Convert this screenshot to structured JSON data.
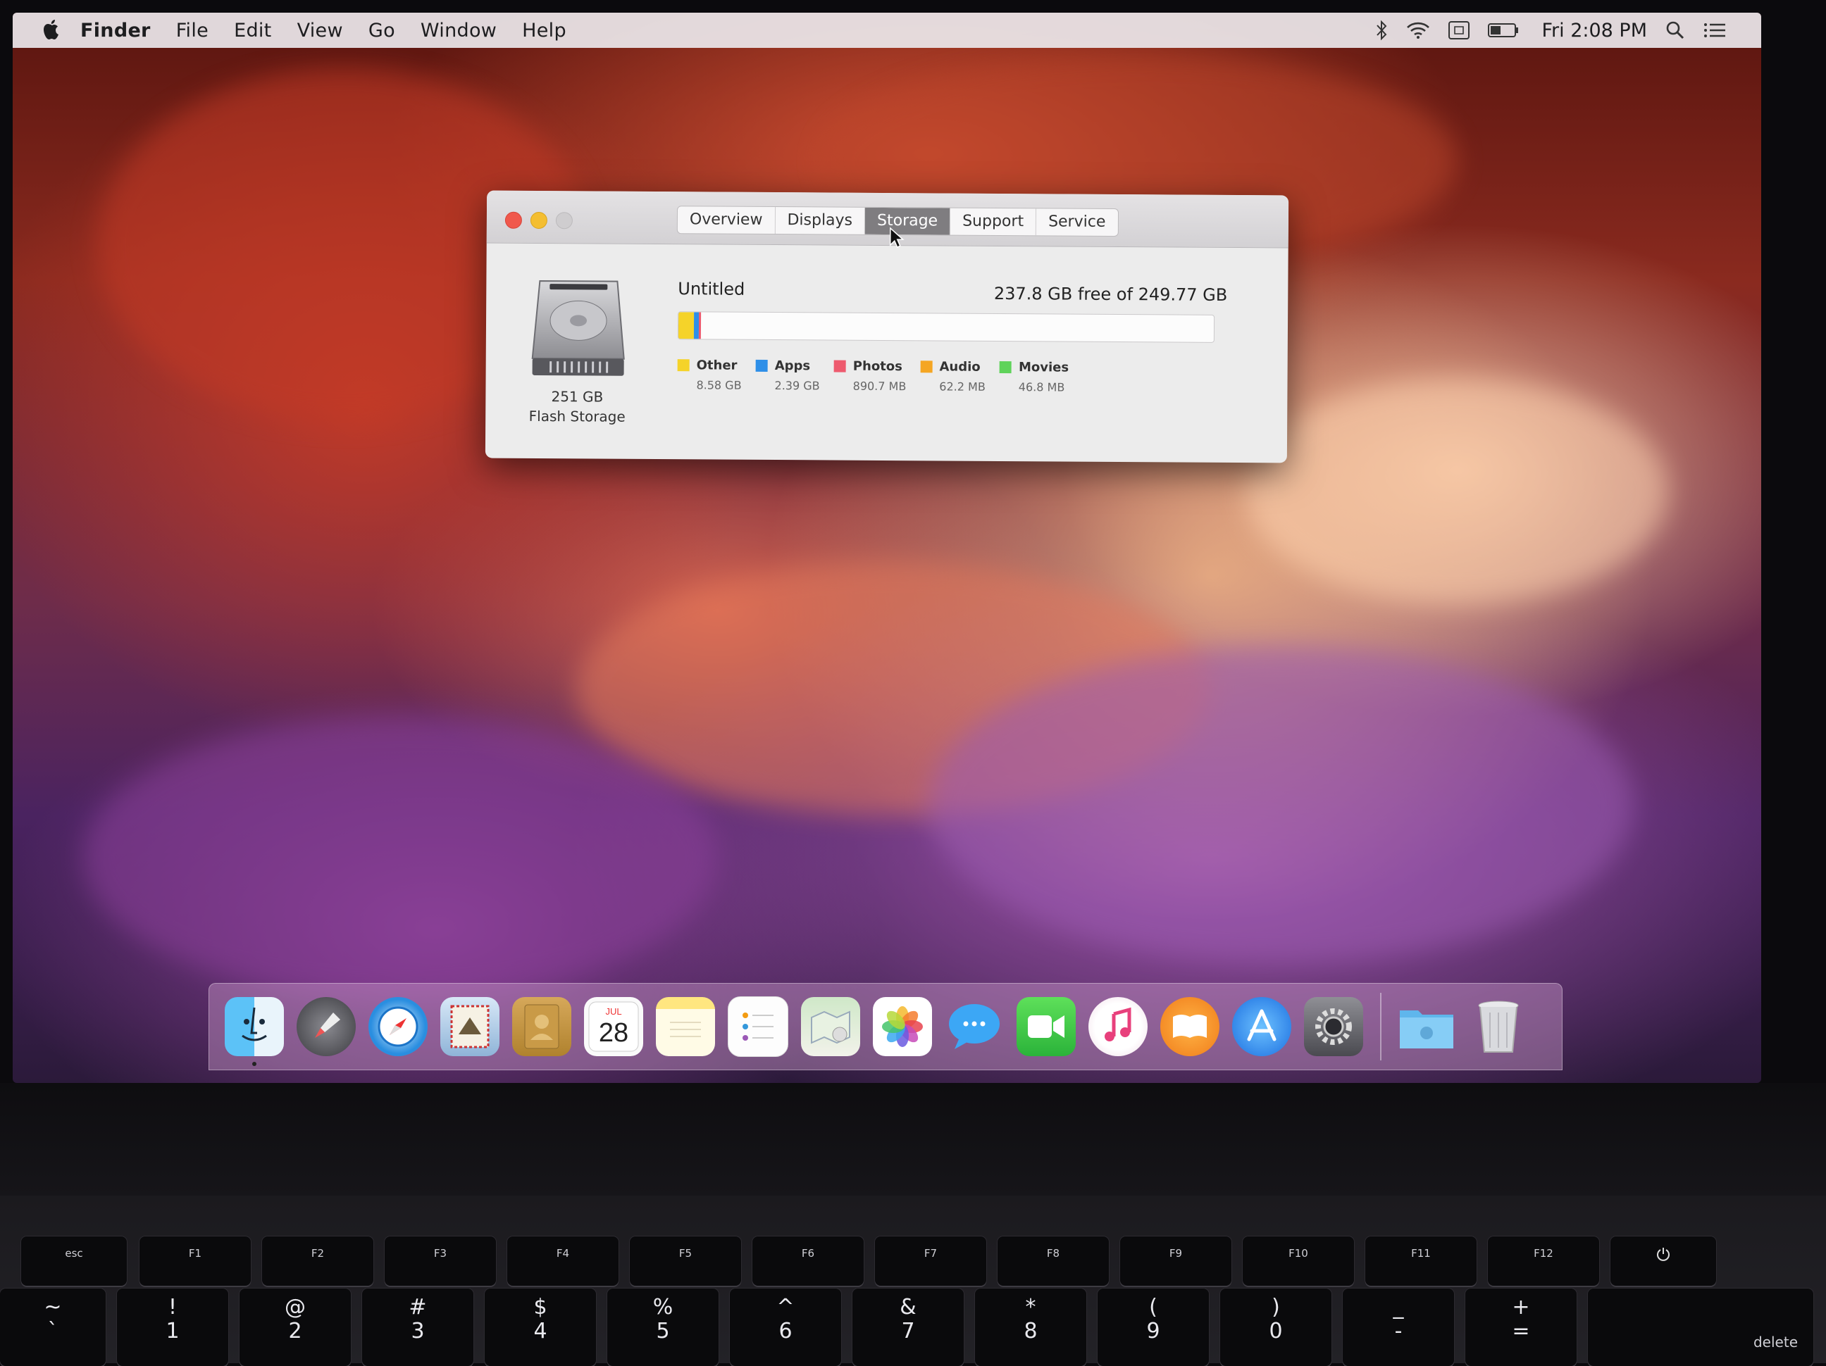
{
  "menubar": {
    "app_name": "Finder",
    "menus": [
      "File",
      "Edit",
      "View",
      "Go",
      "Window",
      "Help"
    ],
    "clock": "Fri 2:08 PM"
  },
  "about_window": {
    "tabs": [
      "Overview",
      "Displays",
      "Storage",
      "Support",
      "Service"
    ],
    "active_tab": "Storage",
    "drive": {
      "size": "251 GB",
      "type": "Flash Storage"
    },
    "volume": {
      "name": "Untitled",
      "free_text": "237.8 GB free of 249.77 GB",
      "categories": [
        {
          "label": "Other",
          "size": "8.58 GB",
          "color": "#f5d329"
        },
        {
          "label": "Apps",
          "size": "2.39 GB",
          "color": "#2e8fe8"
        },
        {
          "label": "Photos",
          "size": "890.7 MB",
          "color": "#ee5a6e"
        },
        {
          "label": "Audio",
          "size": "62.2 MB",
          "color": "#f5a623"
        },
        {
          "label": "Movies",
          "size": "46.8 MB",
          "color": "#5fd35a"
        }
      ]
    }
  },
  "dock": {
    "apps": [
      "finder-icon",
      "launchpad-icon",
      "safari-icon",
      "mail-icon",
      "contacts-icon",
      "calendar-icon",
      "notes-icon",
      "reminders-icon",
      "maps-icon",
      "photos-icon",
      "messages-icon",
      "facetime-icon",
      "itunes-icon",
      "ibooks-icon",
      "app-store-icon",
      "system-preferences-icon"
    ],
    "calendar": {
      "month": "JUL",
      "day": "28"
    },
    "right_items": [
      "downloads-folder-icon",
      "trash-icon"
    ]
  },
  "keyboard": {
    "function_row": [
      "esc",
      "F1",
      "F2",
      "F3",
      "F4",
      "F5",
      "F6",
      "F7",
      "F8",
      "F9",
      "F10",
      "F11",
      "F12"
    ],
    "number_row": [
      {
        "top": "~",
        "bot": "`"
      },
      {
        "top": "!",
        "bot": "1"
      },
      {
        "top": "@",
        "bot": "2"
      },
      {
        "top": "#",
        "bot": "3"
      },
      {
        "top": "$",
        "bot": "4"
      },
      {
        "top": "%",
        "bot": "5"
      },
      {
        "top": "^",
        "bot": "6"
      },
      {
        "top": "&",
        "bot": "7"
      },
      {
        "top": "*",
        "bot": "8"
      },
      {
        "top": "(",
        "bot": "9"
      },
      {
        "top": ")",
        "bot": "0"
      },
      {
        "top": "_",
        "bot": "-"
      },
      {
        "top": "+",
        "bot": "="
      }
    ],
    "delete_label": "delete"
  },
  "colors": {
    "menubar_bg": "#ece8ec",
    "tab_active": "#7f7d80",
    "bar_bg": "#fcfcfc"
  }
}
